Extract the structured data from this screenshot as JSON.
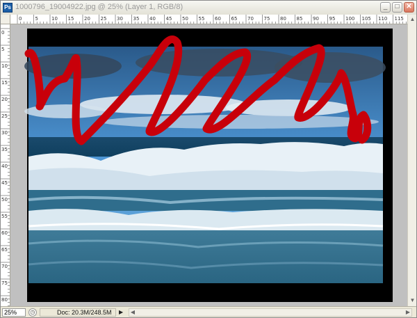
{
  "window": {
    "title": "1000796_19004922.jpg @ 25% (Layer 1, RGB/8)",
    "app_icon_text": "Ps",
    "minimize_glyph": "_",
    "maximize_glyph": "□",
    "close_glyph": "✕"
  },
  "rulers": {
    "horizontal_labels": [
      "0",
      "5",
      "10",
      "15",
      "20",
      "25",
      "30",
      "35",
      "40",
      "45",
      "50",
      "55",
      "60",
      "65",
      "70",
      "75",
      "80",
      "85",
      "90",
      "95",
      "100",
      "105",
      "110",
      "115"
    ],
    "vertical_labels": [
      "0",
      "5",
      "10",
      "15",
      "20",
      "25",
      "30",
      "35",
      "40",
      "45",
      "50",
      "55",
      "60",
      "65",
      "70",
      "75",
      "80"
    ]
  },
  "status": {
    "zoom": "25%",
    "doc_info": "Doc: 20.3M/248.5M",
    "menu_arrow": "▶",
    "scroll_left": "◀",
    "scroll_right": "▶",
    "scroll_up": "▲",
    "scroll_down": "▼"
  },
  "colors": {
    "scribble": "#c8000a",
    "canvas_border": "#000000",
    "workspace": "#c0c0c0",
    "sky_top": "#2a5a8a",
    "sky_mid": "#4d95d4",
    "sea_dark": "#0f3f5e",
    "foam": "#eef6fb"
  }
}
